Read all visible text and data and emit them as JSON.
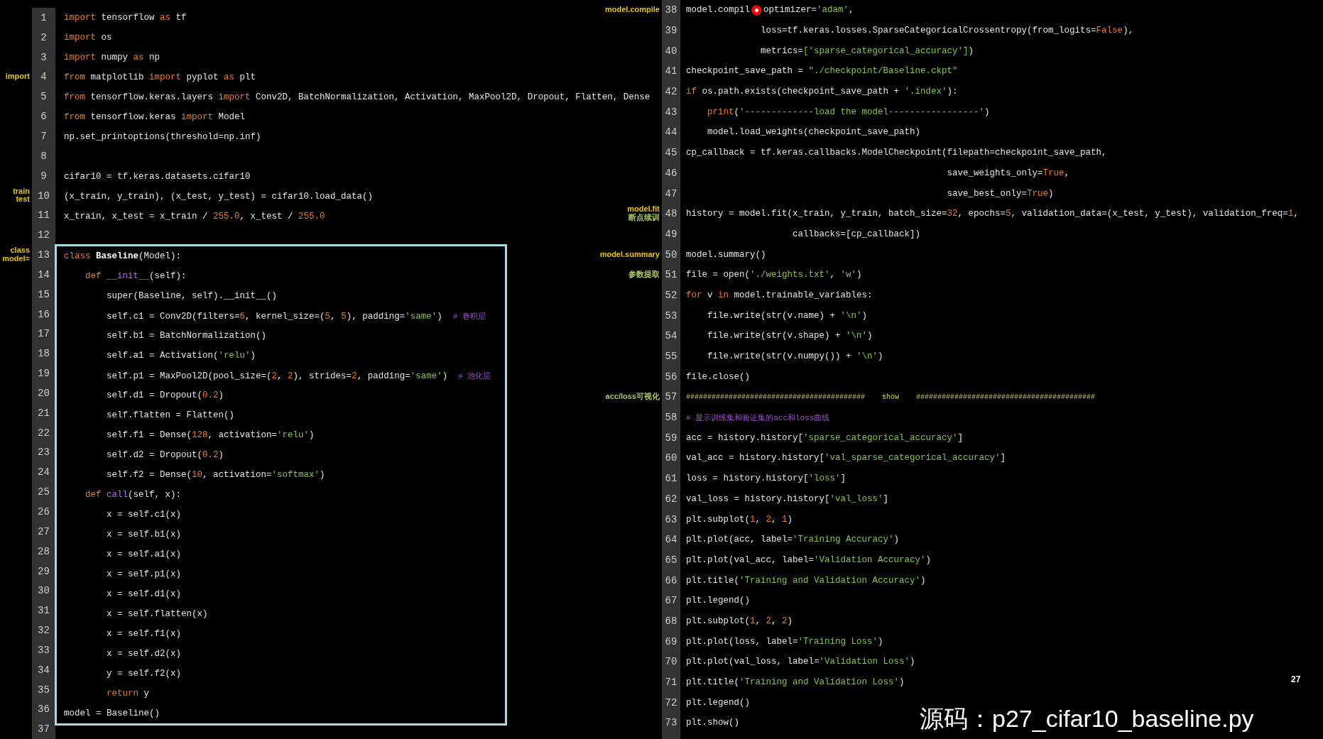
{
  "left_pane": {
    "blocks": [
      {
        "boxed": false,
        "lines": [
          {
            "number": "1",
            "tokens": [
              {
                "kind": "kw",
                "text": "import"
              },
              {
                "kind": "txt",
                "text": " tensorflow "
              },
              {
                "kind": "kw",
                "text": "as"
              },
              {
                "kind": "txt",
                "text": " tf"
              }
            ]
          },
          {
            "number": "2",
            "tokens": [
              {
                "kind": "kw",
                "text": "import"
              },
              {
                "kind": "txt",
                "text": " os"
              }
            ]
          },
          {
            "number": "3",
            "tokens": [
              {
                "kind": "kw",
                "text": "import"
              },
              {
                "kind": "txt",
                "text": " numpy "
              },
              {
                "kind": "kw",
                "text": "as"
              },
              {
                "kind": "txt",
                "text": " np"
              }
            ]
          },
          {
            "number": "4",
            "notes": [
              {
                "text": "import",
                "color": "#e8c41a"
              }
            ],
            "tokens": [
              {
                "kind": "kw",
                "text": "from"
              },
              {
                "kind": "txt",
                "text": " matplotlib "
              },
              {
                "kind": "kw",
                "text": "import"
              },
              {
                "kind": "txt",
                "text": " pyplot "
              },
              {
                "kind": "kw",
                "text": "as"
              },
              {
                "kind": "txt",
                "text": " plt"
              }
            ]
          },
          {
            "number": "5",
            "tokens": [
              {
                "kind": "kw",
                "text": "from"
              },
              {
                "kind": "txt",
                "text": " tensorflow.keras.layers "
              },
              {
                "kind": "kw",
                "text": "import"
              },
              {
                "kind": "txt",
                "text": " Conv2D, BatchNormalization, Activation, MaxPool2D, Dropout, Flatten, Dense"
              }
            ]
          },
          {
            "number": "6",
            "tokens": [
              {
                "kind": "kw",
                "text": "from"
              },
              {
                "kind": "txt",
                "text": " tensorflow.keras "
              },
              {
                "kind": "kw",
                "text": "import"
              },
              {
                "kind": "txt",
                "text": " Model"
              }
            ]
          },
          {
            "number": "7",
            "tokens": [
              {
                "kind": "txt",
                "text": "np.set_printoptions(threshold=np.inf)"
              }
            ]
          },
          {
            "number": "8"
          },
          {
            "number": "9",
            "tokens": [
              {
                "kind": "txt",
                "text": "cifar10 = tf.keras.datasets.cifar10"
              }
            ]
          },
          {
            "number": "10",
            "notes": [
              {
                "text": "train",
                "color": "#e8c41a"
              },
              {
                "text": "test",
                "color": "#e8c41a"
              }
            ],
            "tokens": [
              {
                "kind": "txt",
                "text": "(x_train, y_train), (x_test, y_test) = cifar10.load_data()"
              }
            ]
          },
          {
            "number": "11",
            "tokens": [
              {
                "kind": "txt",
                "text": "x_train, x_test = x_train / "
              },
              {
                "kind": "num",
                "text": "255.0"
              },
              {
                "kind": "txt",
                "text": ", x_test / "
              },
              {
                "kind": "num",
                "text": "255.0"
              }
            ]
          },
          {
            "number": "12"
          }
        ]
      },
      {
        "boxed": true,
        "lines": [
          {
            "number": "13",
            "notes": [
              {
                "text": "class",
                "color": "#e8c41a"
              },
              {
                "text": "model=",
                "color": "#e8c41a"
              }
            ],
            "tokens": [
              {
                "kind": "kw",
                "text": "class"
              },
              {
                "kind": "name",
                "text": " Baseline"
              },
              {
                "kind": "txt",
                "text": "(Model):"
              }
            ]
          },
          {
            "number": "14",
            "tokens": [
              {
                "kind": "kw",
                "text": "    def"
              },
              {
                "kind": "fn",
                "text": " __init__"
              },
              {
                "kind": "txt",
                "text": "(self):"
              }
            ]
          },
          {
            "number": "15",
            "tokens": [
              {
                "kind": "txt",
                "text": "        super(Baseline, self).__init__()"
              }
            ]
          },
          {
            "number": "16",
            "tokens": [
              {
                "kind": "txt",
                "text": "        self.c1 = Conv2D(filters="
              },
              {
                "kind": "num",
                "text": "6"
              },
              {
                "kind": "txt",
                "text": ", kernel_size=("
              },
              {
                "kind": "num",
                "text": "5"
              },
              {
                "kind": "txt",
                "text": ", "
              },
              {
                "kind": "num",
                "text": "5"
              },
              {
                "kind": "txt",
                "text": "), padding="
              },
              {
                "kind": "str",
                "text": "'same'"
              },
              {
                "kind": "txt",
                "text": ")  "
              },
              {
                "kind": "cmt",
                "text": "# 卷积层"
              }
            ]
          },
          {
            "number": "17",
            "tokens": [
              {
                "kind": "txt",
                "text": "        self.b1 = BatchNormalization()"
              }
            ]
          },
          {
            "number": "18",
            "tokens": [
              {
                "kind": "txt",
                "text": "        self.a1 = Activation("
              },
              {
                "kind": "str",
                "text": "'relu'"
              },
              {
                "kind": "txt",
                "text": ")"
              }
            ]
          },
          {
            "number": "19",
            "tokens": [
              {
                "kind": "txt",
                "text": "        self.p1 = MaxPool2D(pool_size=("
              },
              {
                "kind": "num",
                "text": "2"
              },
              {
                "kind": "txt",
                "text": ", "
              },
              {
                "kind": "num",
                "text": "2"
              },
              {
                "kind": "txt",
                "text": "), strides="
              },
              {
                "kind": "num",
                "text": "2"
              },
              {
                "kind": "txt",
                "text": ", padding="
              },
              {
                "kind": "str",
                "text": "'same'"
              },
              {
                "kind": "txt",
                "text": ")  "
              },
              {
                "kind": "cmt",
                "text": "# 池化层"
              }
            ]
          },
          {
            "number": "20",
            "tokens": [
              {
                "kind": "txt",
                "text": "        self.d1 = Dropout("
              },
              {
                "kind": "num",
                "text": "0.2"
              },
              {
                "kind": "txt",
                "text": ")"
              }
            ]
          },
          {
            "number": "21",
            "tokens": [
              {
                "kind": "txt",
                "text": "        self.flatten = Flatten()"
              }
            ]
          },
          {
            "number": "22",
            "tokens": [
              {
                "kind": "txt",
                "text": "        self.f1 = Dense("
              },
              {
                "kind": "num",
                "text": "128"
              },
              {
                "kind": "txt",
                "text": ", activation="
              },
              {
                "kind": "str",
                "text": "'relu'"
              },
              {
                "kind": "txt",
                "text": ")"
              }
            ]
          },
          {
            "number": "23",
            "tokens": [
              {
                "kind": "txt",
                "text": "        self.d2 = Dropout("
              },
              {
                "kind": "num",
                "text": "0.2"
              },
              {
                "kind": "txt",
                "text": ")"
              }
            ]
          },
          {
            "number": "24",
            "tokens": [
              {
                "kind": "txt",
                "text": "        self.f2 = Dense("
              },
              {
                "kind": "num",
                "text": "10"
              },
              {
                "kind": "txt",
                "text": ", activation="
              },
              {
                "kind": "str",
                "text": "'softmax'"
              },
              {
                "kind": "txt",
                "text": ")"
              }
            ]
          },
          {
            "number": "25",
            "tokens": [
              {
                "kind": "kw",
                "text": "    def"
              },
              {
                "kind": "fn",
                "text": " call"
              },
              {
                "kind": "txt",
                "text": "(self, x):"
              }
            ]
          },
          {
            "number": "26",
            "tokens": [
              {
                "kind": "txt",
                "text": "        x = self.c1(x)"
              }
            ]
          },
          {
            "number": "27",
            "tokens": [
              {
                "kind": "txt",
                "text": "        x = self.b1(x)"
              }
            ]
          },
          {
            "number": "28",
            "tokens": [
              {
                "kind": "txt",
                "text": "        x = self.a1(x)"
              }
            ]
          },
          {
            "number": "29",
            "tokens": [
              {
                "kind": "txt",
                "text": "        x = self.p1(x)"
              }
            ]
          },
          {
            "number": "30",
            "tokens": [
              {
                "kind": "txt",
                "text": "        x = self.d1(x)"
              }
            ]
          },
          {
            "number": "31",
            "tokens": [
              {
                "kind": "txt",
                "text": "        x = self.flatten(x)"
              }
            ]
          },
          {
            "number": "32",
            "tokens": [
              {
                "kind": "txt",
                "text": "        x = self.f1(x)"
              }
            ]
          },
          {
            "number": "33",
            "tokens": [
              {
                "kind": "txt",
                "text": "        x = self.d2(x)"
              }
            ]
          },
          {
            "number": "34",
            "tokens": [
              {
                "kind": "txt",
                "text": "        y = self.f2(x)"
              }
            ]
          },
          {
            "number": "35",
            "tokens": [
              {
                "kind": "kw",
                "text": "        return"
              },
              {
                "kind": "txt",
                "text": " y"
              }
            ]
          },
          {
            "number": "36",
            "tokens": [
              {
                "kind": "txt",
                "text": "model = Baseline()"
              }
            ]
          }
        ]
      },
      {
        "boxed": false,
        "lines": [
          {
            "number": "37"
          }
        ]
      }
    ]
  },
  "right_pane": {
    "blocks": [
      {
        "lines": [
          {
            "number": "38",
            "notes": [
              {
                "text": "model.compile",
                "color": "#e8c41a"
              }
            ],
            "tokens": [
              {
                "kind": "txt",
                "text": "model.compil"
              },
              {
                "kind": "pointer"
              },
              {
                "kind": "txt",
                "text": "optimizer="
              },
              {
                "kind": "str",
                "text": "'adam'"
              },
              {
                "kind": "txt",
                "text": ","
              }
            ]
          },
          {
            "number": "39",
            "tokens": [
              {
                "kind": "txt",
                "text": "              loss=tf.keras.losses.SparseCategoricalCrossentropy(from_logits="
              },
              {
                "kind": "kw",
                "text": "False"
              },
              {
                "kind": "txt",
                "text": "),"
              }
            ]
          },
          {
            "number": "40",
            "tokens": [
              {
                "kind": "txt",
                "text": "              metrics="
              },
              {
                "kind": "str",
                "text": "['sparse_categorical_accuracy']"
              },
              {
                "kind": "txt",
                "text": ")"
              }
            ]
          },
          {
            "number": "41",
            "tokens": [
              {
                "kind": "txt",
                "text": "checkpoint_save_path = "
              },
              {
                "kind": "str",
                "text": "\"./checkpoint/Baseline.ckpt\""
              }
            ]
          },
          {
            "number": "42",
            "tokens": [
              {
                "kind": "kw",
                "text": "if"
              },
              {
                "kind": "txt",
                "text": " os.path.exists(checkpoint_save_path + "
              },
              {
                "kind": "str",
                "text": "'.index'"
              },
              {
                "kind": "txt",
                "text": "):"
              }
            ]
          },
          {
            "number": "43",
            "tokens": [
              {
                "kind": "kw",
                "text": "    print"
              },
              {
                "kind": "txt",
                "text": "("
              },
              {
                "kind": "str",
                "text": "'-------------load the model-----------------'"
              },
              {
                "kind": "txt",
                "text": ")"
              }
            ]
          },
          {
            "number": "44",
            "tokens": [
              {
                "kind": "txt",
                "text": "    model.load_weights(checkpoint_save_path)"
              }
            ]
          },
          {
            "number": "45",
            "tokens": [
              {
                "kind": "txt",
                "text": "cp_callback = tf.keras.callbacks.ModelCheckpoint(filepath=checkpoint_save_path,"
              }
            ]
          },
          {
            "number": "46",
            "tokens": [
              {
                "kind": "txt",
                "text": "                                                 save_weights_only="
              },
              {
                "kind": "kw",
                "text": "True"
              },
              {
                "kind": "txt",
                "text": ","
              }
            ]
          },
          {
            "number": "47",
            "tokens": [
              {
                "kind": "txt",
                "text": "                                                 save_best_only="
              },
              {
                "kind": "kw",
                "text": "True"
              },
              {
                "kind": "txt",
                "text": ")"
              }
            ]
          },
          {
            "number": "48",
            "notes": [
              {
                "text": "model.fit",
                "color": "#e8c41a"
              },
              {
                "text": "断点续训",
                "color": "#a8c864"
              }
            ],
            "tokens": [
              {
                "kind": "txt",
                "text": "history = model.fit(x_train, y_train, batch_size="
              },
              {
                "kind": "num",
                "text": "32"
              },
              {
                "kind": "txt",
                "text": ", epochs="
              },
              {
                "kind": "num",
                "text": "5"
              },
              {
                "kind": "txt",
                "text": ", validation_data=(x_test, y_test), validation_freq="
              },
              {
                "kind": "num",
                "text": "1"
              },
              {
                "kind": "txt",
                "text": ","
              }
            ]
          },
          {
            "number": "49",
            "tokens": [
              {
                "kind": "txt",
                "text": "                    callbacks=[cp_callback])"
              }
            ]
          },
          {
            "number": "50",
            "notes": [
              {
                "text": "model.summary",
                "color": "#e8c41a"
              }
            ],
            "tokens": [
              {
                "kind": "txt",
                "text": "model.summary()"
              }
            ]
          },
          {
            "number": "51",
            "notes": [
              {
                "text": "参数提取",
                "color": "#a8c864"
              }
            ],
            "tokens": [
              {
                "kind": "txt",
                "text": "file = open("
              },
              {
                "kind": "str",
                "text": "'./weights.txt'"
              },
              {
                "kind": "txt",
                "text": ", "
              },
              {
                "kind": "str",
                "text": "'w'"
              },
              {
                "kind": "txt",
                "text": ")"
              }
            ]
          },
          {
            "number": "52",
            "tokens": [
              {
                "kind": "kw",
                "text": "for"
              },
              {
                "kind": "txt",
                "text": " v "
              },
              {
                "kind": "kw",
                "text": "in"
              },
              {
                "kind": "txt",
                "text": " model.trainable_variables:"
              }
            ]
          },
          {
            "number": "53",
            "tokens": [
              {
                "kind": "txt",
                "text": "    file.write(str(v.name) + "
              },
              {
                "kind": "str",
                "text": "'\\n'"
              },
              {
                "kind": "txt",
                "text": ")"
              }
            ]
          },
          {
            "number": "54",
            "tokens": [
              {
                "kind": "txt",
                "text": "    file.write(str(v.shape) + "
              },
              {
                "kind": "str",
                "text": "'\\n'"
              },
              {
                "kind": "txt",
                "text": ")"
              }
            ]
          },
          {
            "number": "55",
            "tokens": [
              {
                "kind": "txt",
                "text": "    file.write(str(v.numpy()) + "
              },
              {
                "kind": "str",
                "text": "'\\n'"
              },
              {
                "kind": "txt",
                "text": ")"
              }
            ]
          },
          {
            "number": "56",
            "tokens": [
              {
                "kind": "txt",
                "text": "file.close()"
              }
            ]
          },
          {
            "number": "57",
            "notes": [
              {
                "text": "acc/loss可视化",
                "color": "#a8c864"
              }
            ],
            "tokens": [
              {
                "kind": "hash",
                "text": "##########################################    show    ##########################################"
              }
            ]
          },
          {
            "number": "58",
            "tokens": [
              {
                "kind": "cmt",
                "text": "# 显示训练集和验证集的acc和loss曲线"
              }
            ]
          },
          {
            "number": "59",
            "tokens": [
              {
                "kind": "txt",
                "text": "acc = history.history["
              },
              {
                "kind": "str",
                "text": "'sparse_categorical_accuracy'"
              },
              {
                "kind": "txt",
                "text": "]"
              }
            ]
          },
          {
            "number": "60",
            "tokens": [
              {
                "kind": "txt",
                "text": "val_acc = history.history["
              },
              {
                "kind": "str",
                "text": "'val_sparse_categorical_accuracy'"
              },
              {
                "kind": "txt",
                "text": "]"
              }
            ]
          },
          {
            "number": "61",
            "tokens": [
              {
                "kind": "txt",
                "text": "loss = history.history["
              },
              {
                "kind": "str",
                "text": "'loss'"
              },
              {
                "kind": "txt",
                "text": "]"
              }
            ]
          },
          {
            "number": "62",
            "tokens": [
              {
                "kind": "txt",
                "text": "val_loss = history.history["
              },
              {
                "kind": "str",
                "text": "'val_loss'"
              },
              {
                "kind": "txt",
                "text": "]"
              }
            ]
          },
          {
            "number": "63",
            "tokens": [
              {
                "kind": "txt",
                "text": "plt.subplot("
              },
              {
                "kind": "num",
                "text": "1"
              },
              {
                "kind": "txt",
                "text": ", "
              },
              {
                "kind": "num",
                "text": "2"
              },
              {
                "kind": "txt",
                "text": ", "
              },
              {
                "kind": "num",
                "text": "1"
              },
              {
                "kind": "txt",
                "text": ")"
              }
            ]
          },
          {
            "number": "64",
            "tokens": [
              {
                "kind": "txt",
                "text": "plt.plot(acc, label="
              },
              {
                "kind": "str",
                "text": "'Training Accuracy'"
              },
              {
                "kind": "txt",
                "text": ")"
              }
            ]
          },
          {
            "number": "65",
            "tokens": [
              {
                "kind": "txt",
                "text": "plt.plot(val_acc, label="
              },
              {
                "kind": "str",
                "text": "'Validation Accuracy'"
              },
              {
                "kind": "txt",
                "text": ")"
              }
            ]
          },
          {
            "number": "66",
            "tokens": [
              {
                "kind": "txt",
                "text": "plt.title("
              },
              {
                "kind": "str",
                "text": "'Training and Validation Accuracy'"
              },
              {
                "kind": "txt",
                "text": ")"
              }
            ]
          },
          {
            "number": "67",
            "tokens": [
              {
                "kind": "txt",
                "text": "plt.legend()"
              }
            ]
          },
          {
            "number": "68",
            "tokens": [
              {
                "kind": "txt",
                "text": "plt.subplot("
              },
              {
                "kind": "num",
                "text": "1"
              },
              {
                "kind": "txt",
                "text": ", "
              },
              {
                "kind": "num",
                "text": "2"
              },
              {
                "kind": "txt",
                "text": ", "
              },
              {
                "kind": "num",
                "text": "2"
              },
              {
                "kind": "txt",
                "text": ")"
              }
            ]
          },
          {
            "number": "69",
            "tokens": [
              {
                "kind": "txt",
                "text": "plt.plot(loss, label="
              },
              {
                "kind": "str",
                "text": "'Training Loss'"
              },
              {
                "kind": "txt",
                "text": ")"
              }
            ]
          },
          {
            "number": "70",
            "tokens": [
              {
                "kind": "txt",
                "text": "plt.plot(val_loss, label="
              },
              {
                "kind": "str",
                "text": "'Validation Loss'"
              },
              {
                "kind": "txt",
                "text": ")"
              }
            ]
          },
          {
            "number": "71",
            "tokens": [
              {
                "kind": "txt",
                "text": "plt.title("
              },
              {
                "kind": "str",
                "text": "'Training and Validation Loss'"
              },
              {
                "kind": "txt",
                "text": ")"
              }
            ]
          },
          {
            "number": "72",
            "tokens": [
              {
                "kind": "txt",
                "text": "plt.legend()"
              }
            ]
          },
          {
            "number": "73",
            "tokens": [
              {
                "kind": "txt",
                "text": "plt.show()"
              }
            ]
          }
        ]
      }
    ]
  },
  "page_number": "27",
  "caption": "源码：p27_cifar10_baseline.py"
}
